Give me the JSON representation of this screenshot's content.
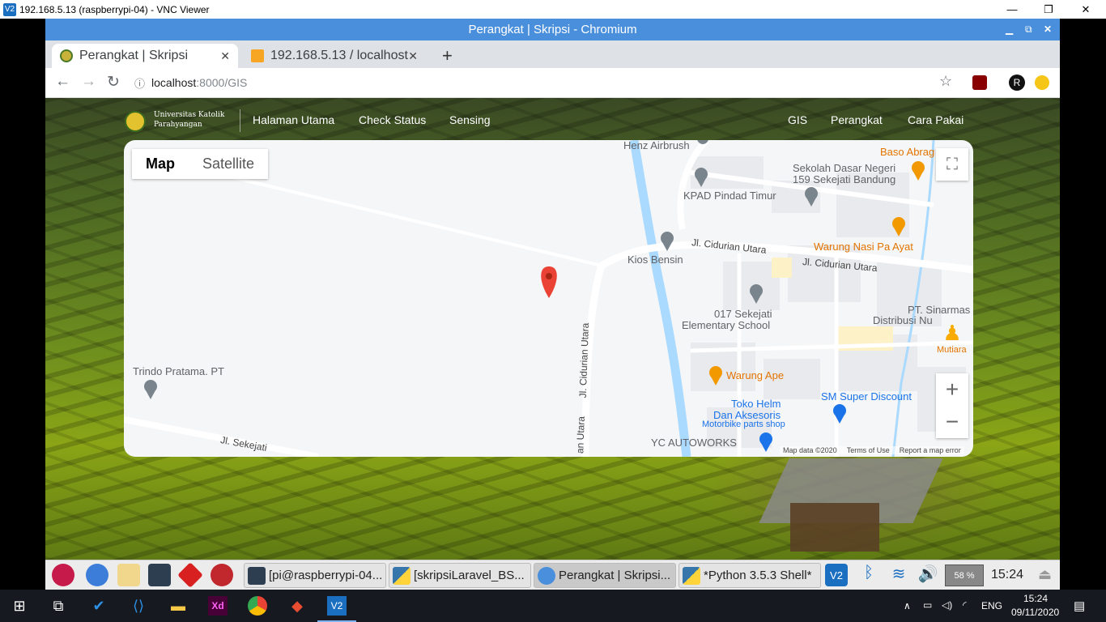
{
  "vnc": {
    "title": "192.168.5.13 (raspberrypi-04) - VNC Viewer",
    "icon": "vnc-icon",
    "controls": [
      "—",
      "❐",
      "✕"
    ]
  },
  "chrome": {
    "window_title": "Perangkat | Skripsi - Chromium",
    "tabs": [
      {
        "label": "Perangkat | Skripsi",
        "icon": "ukp-favicon"
      },
      {
        "label": "192.168.5.13 / localhost",
        "icon": "phpmyadmin-favicon"
      }
    ],
    "url_host": "localhost",
    "url_rest": ":8000/GIS"
  },
  "nav": {
    "logo_text_1": "Universitas Katolik",
    "logo_text_2": "Parahyangan",
    "left_links": [
      "Halaman Utama",
      "Check Status",
      "Sensing"
    ],
    "right_links": [
      "GIS",
      "Perangkat",
      "Cara Pakai"
    ]
  },
  "map": {
    "type_map": "Map",
    "type_satellite": "Satellite",
    "zoom_in": "+",
    "zoom_out": "−",
    "labels": {
      "henz": "Henz Airbrush",
      "sekolah1": "Sekolah Dasar Negeri",
      "sekolah2": "159 Sekejati Bandung",
      "kpad": "KPAD Pindad Timur",
      "baso": "Baso Abrag",
      "warung_nasi": "Warung Nasi Pa Ayat",
      "kios": "Kios Bensin",
      "jl_cidurian_1": "Jl. Cidurian Utara",
      "jl_cidurian_2": "Jl. Cidurian Utara",
      "jl_cidurian_v": "Jl. Cidurian Utara",
      "jl_cidurian_v2": "an Utara",
      "school1": "017 Sekejati",
      "school2": "Elementary School",
      "pt1": "PT. Sinarmas",
      "pt2": "Distribusi Nu",
      "mutiara": "Mutiara",
      "trindo": "Trindo Pratama. PT",
      "warung_ape": "Warung Ape",
      "toko1": "Toko Helm",
      "toko2": "Dan Aksesoris",
      "toko3": "Motorbike parts shop",
      "sm": "SM Super Discount",
      "yc": "YC AUTOWORKS",
      "jl_sekejati": "Jl. Sekejati"
    },
    "footer": {
      "data": "Map data ©2020",
      "terms": "Terms of Use",
      "report": "Report a map error"
    }
  },
  "rpi_panel": {
    "tasks": [
      "[pi@raspberrypi-04...",
      "[skripsiLaravel_BS...",
      "Perangkat | Skripsi...",
      "*Python 3.5.3 Shell*"
    ],
    "cpu": "58 %",
    "time": "15:24"
  },
  "windows_taskbar": {
    "lang": "ENG",
    "time": "15:24",
    "date": "09/11/2020"
  },
  "colors": {
    "chrome_blue": "#4a8fdc",
    "map_water": "#aadaff",
    "pin_red": "#ea4335",
    "poi_orange": "#f29900"
  }
}
